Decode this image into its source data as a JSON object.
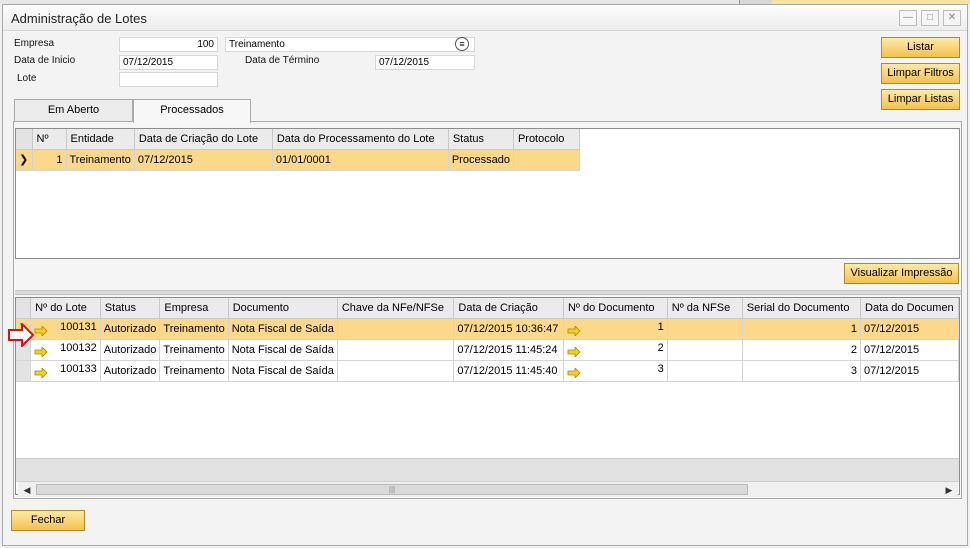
{
  "window": {
    "title": "Administração de Lotes"
  },
  "filters": {
    "empresa_label": "Empresa",
    "empresa_code": "100",
    "empresa_name": "Treinamento",
    "data_inicio_label": "Data de Inicio",
    "data_inicio_value": "07/12/2015",
    "data_termino_label": "Data de Término",
    "data_termino_value": "07/12/2015",
    "lote_label": "Lote",
    "lote_value": ""
  },
  "buttons": {
    "listar": "Listar",
    "limpar_filtros": "Limpar Filtros",
    "limpar_listas": "Limpar Listas",
    "visualizar_impressao": "Visualizar Impressão",
    "fechar": "Fechar"
  },
  "tabs": [
    {
      "label": "Em Aberto",
      "active": false
    },
    {
      "label": "Processados",
      "active": true
    }
  ],
  "lotes_grid": {
    "headers": [
      "Nº",
      "Entidade",
      "Data de Criação do Lote",
      "Data do Processamento do Lote",
      "Status",
      "Protocolo"
    ],
    "rows": [
      {
        "n": "1",
        "entidade": "Treinamento",
        "data_criacao": "07/12/2015",
        "data_processamento": "01/01/0001",
        "status": "Processado",
        "protocolo": ""
      }
    ]
  },
  "docs_grid": {
    "headers": [
      "Nº do Lote",
      "Status",
      "Empresa",
      "Documento",
      "Chave da NFe/NFSe",
      "Data de Criação",
      "Nº do Documento",
      "Nº da NFSe",
      "Serial do Documento",
      "Data do Documen"
    ],
    "rows": [
      {
        "lote": "100131",
        "status": "Autorizado",
        "empresa": "Treinamento",
        "documento": "Nota Fiscal de Saída",
        "chave": "",
        "data_criacao": "07/12/2015 10:36:47",
        "num_doc": "1",
        "num_nfse": "",
        "serial": "1",
        "data_doc": "07/12/2015"
      },
      {
        "lote": "100132",
        "status": "Autorizado",
        "empresa": "Treinamento",
        "documento": "Nota Fiscal de Saída",
        "chave": "",
        "data_criacao": "07/12/2015 11:45:24",
        "num_doc": "2",
        "num_nfse": "",
        "serial": "2",
        "data_doc": "07/12/2015"
      },
      {
        "lote": "100133",
        "status": "Autorizado",
        "empresa": "Treinamento",
        "documento": "Nota Fiscal de Saída",
        "chave": "",
        "data_criacao": "07/12/2015 11:45:40",
        "num_doc": "3",
        "num_nfse": "",
        "serial": "3",
        "data_doc": "07/12/2015"
      }
    ]
  },
  "colors": {
    "selected_row": "#fbd88a",
    "button": "#f4c14e",
    "annotation_arrow": "#e01010"
  }
}
